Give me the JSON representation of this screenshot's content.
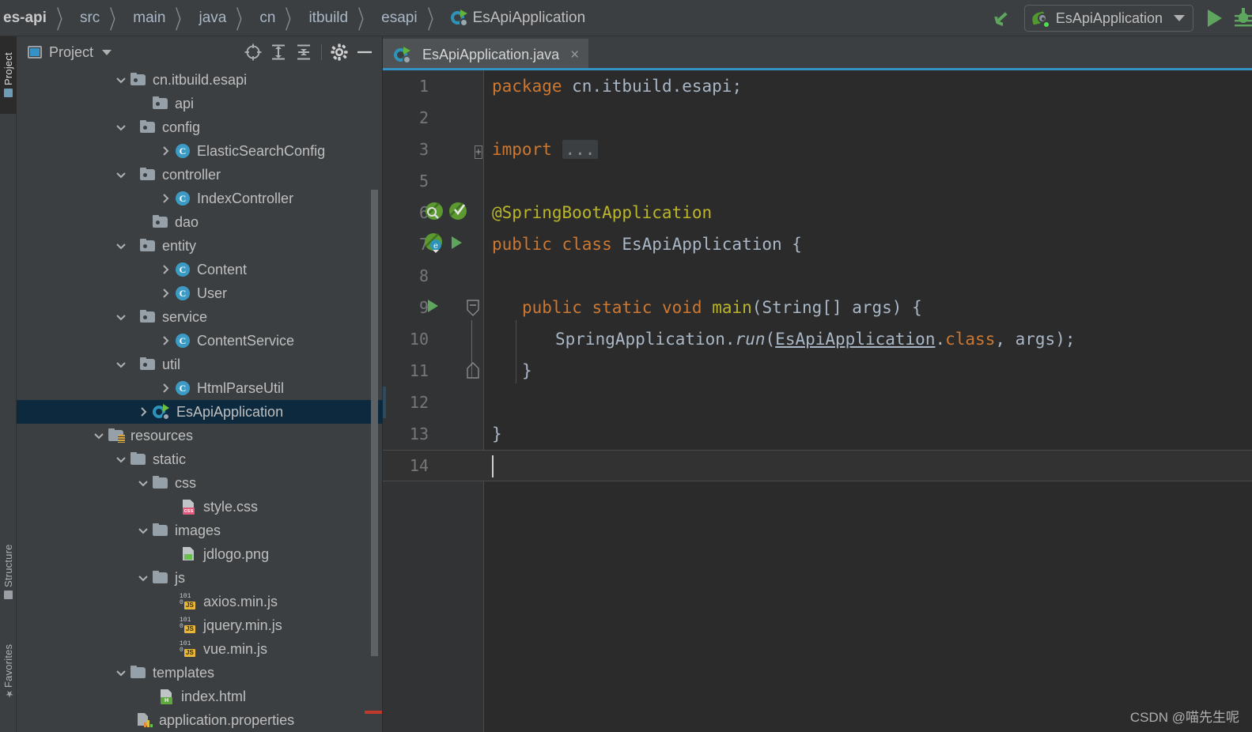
{
  "breadcrumb": {
    "items": [
      "es-api",
      "src",
      "main",
      "java",
      "cn",
      "itbuild",
      "esapi",
      "EsApiApplication"
    ],
    "separator": "〉",
    "last_icon": "spring-boot-application-icon"
  },
  "toolbar": {
    "undo_icon": "undo-arrow-icon",
    "run_config_name": "EsApiApplication",
    "run_config_caret": "▼",
    "run_button_icon": "run-triangle-icon",
    "debug_button_icon": "debug-bug-icon"
  },
  "left_strip": {
    "buttons": [
      {
        "label": "Project",
        "icon": "project-window-icon",
        "active": true
      },
      {
        "label": "Structure",
        "icon": "structure-icon",
        "active": false
      },
      {
        "label": "Favorites",
        "icon": "star-icon",
        "active": false
      }
    ]
  },
  "project_panel": {
    "title": "Project",
    "caret": "▼",
    "actions": [
      {
        "name": "locate-in-tree",
        "icon": "crosshair-icon"
      },
      {
        "name": "expand-all",
        "icon": "expand-all-icon"
      },
      {
        "name": "collapse-all",
        "icon": "collapse-all-icon"
      },
      {
        "name": "settings",
        "icon": "gear-icon"
      },
      {
        "name": "hide",
        "icon": "minus-icon"
      }
    ],
    "tree": [
      {
        "label": "cn.itbuild.esapi",
        "icon": "package-folder",
        "indent": 0,
        "arrow": "down"
      },
      {
        "label": "api",
        "icon": "package-folder",
        "indent": 1,
        "arrow": "none"
      },
      {
        "label": "config",
        "icon": "package-folder",
        "indent": 1,
        "arrow": "down"
      },
      {
        "label": "ElasticSearchConfig",
        "icon": "java-class",
        "indent": 2,
        "arrow": "right"
      },
      {
        "label": "controller",
        "icon": "package-folder",
        "indent": 1,
        "arrow": "down"
      },
      {
        "label": "IndexController",
        "icon": "java-class",
        "indent": 2,
        "arrow": "right"
      },
      {
        "label": "dao",
        "icon": "package-folder",
        "indent": 1,
        "arrow": "none"
      },
      {
        "label": "entity",
        "icon": "package-folder",
        "indent": 1,
        "arrow": "down"
      },
      {
        "label": "Content",
        "icon": "java-class",
        "indent": 2,
        "arrow": "right"
      },
      {
        "label": "User",
        "icon": "java-class",
        "indent": 2,
        "arrow": "right"
      },
      {
        "label": "service",
        "icon": "package-folder",
        "indent": 1,
        "arrow": "down"
      },
      {
        "label": "ContentService",
        "icon": "java-class",
        "indent": 2,
        "arrow": "right"
      },
      {
        "label": "util",
        "icon": "package-folder",
        "indent": 1,
        "arrow": "down"
      },
      {
        "label": "HtmlParseUtil",
        "icon": "java-class",
        "indent": 2,
        "arrow": "right"
      },
      {
        "label": "EsApiApplication",
        "icon": "spring-boot-run-class",
        "indent": 1,
        "arrow": "right",
        "selected": true
      },
      {
        "label": "resources",
        "icon": "resources-folder",
        "indent": 0,
        "arrow": "down"
      },
      {
        "label": "static",
        "icon": "plain-folder",
        "indent": 1,
        "arrow": "down"
      },
      {
        "label": "css",
        "icon": "plain-folder",
        "indent": 2,
        "arrow": "down"
      },
      {
        "label": "style.css",
        "icon": "css-file",
        "indent": 3,
        "arrow": "none",
        "badge": "css"
      },
      {
        "label": "images",
        "icon": "plain-folder",
        "indent": 2,
        "arrow": "down"
      },
      {
        "label": "jdlogo.png",
        "icon": "image-file",
        "indent": 3,
        "arrow": "none"
      },
      {
        "label": "js",
        "icon": "plain-folder",
        "indent": 2,
        "arrow": "down"
      },
      {
        "label": "axios.min.js",
        "icon": "js-file",
        "indent": 3,
        "arrow": "none",
        "badge": "JS"
      },
      {
        "label": "jquery.min.js",
        "icon": "js-file",
        "indent": 3,
        "arrow": "none",
        "badge": "JS"
      },
      {
        "label": "vue.min.js",
        "icon": "js-file",
        "indent": 3,
        "arrow": "none",
        "badge": "JS"
      },
      {
        "label": "templates",
        "icon": "plain-folder",
        "indent": 1,
        "arrow": "down"
      },
      {
        "label": "index.html",
        "icon": "html-file",
        "indent": 2,
        "arrow": "none",
        "badge": "H"
      },
      {
        "label": "application.properties",
        "icon": "properties-file",
        "indent": 1,
        "arrow": "none"
      }
    ]
  },
  "editor": {
    "tab": {
      "title": "EsApiApplication.java",
      "icon": "spring-boot-application-icon",
      "close": "×",
      "active": true
    },
    "lines": [
      {
        "num": "1",
        "gutter": [],
        "fold": null
      },
      {
        "num": "2",
        "gutter": [],
        "fold": null
      },
      {
        "num": "3",
        "gutter": [],
        "fold": "plus"
      },
      {
        "num": "5",
        "gutter": [],
        "fold": null
      },
      {
        "num": "6",
        "gutter": [
          "spring-bean-search-icon",
          "spring-bean-check-icon"
        ],
        "fold": null
      },
      {
        "num": "7",
        "gutter": [
          "spring-bean-config-icon",
          "run-gutter-icon"
        ],
        "fold": null
      },
      {
        "num": "8",
        "gutter": [],
        "fold": null
      },
      {
        "num": "9",
        "gutter": [
          "run-gutter-icon"
        ],
        "fold": "collapse-top"
      },
      {
        "num": "10",
        "gutter": [],
        "fold": null
      },
      {
        "num": "11",
        "gutter": [],
        "fold": "collapse-bottom"
      },
      {
        "num": "12",
        "gutter": [],
        "fold": null
      },
      {
        "num": "13",
        "gutter": [],
        "fold": null
      },
      {
        "num": "14",
        "gutter": [],
        "fold": null,
        "caret": true
      }
    ],
    "code": {
      "l1_kw": "package",
      "l1_pkg": " cn.itbuild.esapi;",
      "l3_kw": "import",
      "l3_fold": "...",
      "l6_annotation": "@SpringBootApplication",
      "l7_kw1": "public class",
      "l7_cls": " EsApiApplication {",
      "l9_kw": "public static void",
      "l9_main": " main",
      "l9_sig": "(String[] args) {",
      "l10_obj": "SpringApplication.",
      "l10_run": "run",
      "l10_p1": "(",
      "l10_link": "EsApiApplication",
      "l10_dot": ".",
      "l10_class_kw": "class",
      "l10_tail": ", args);",
      "l11_brace": "}",
      "l13_brace": "}"
    }
  },
  "watermark": {
    "text": "CSDN @喵先生呢"
  },
  "colors": {
    "panel_bg": "#3C3F41",
    "editor_bg": "#2B2B2B",
    "gutter_bg": "#313335",
    "selection_bg": "#0D293E",
    "accent_blue": "#3592C4",
    "keyword_orange": "#CC7832",
    "annotation_yellow": "#BBB529",
    "text_gray": "#A9B7C6",
    "green_run": "#5EA65E"
  }
}
